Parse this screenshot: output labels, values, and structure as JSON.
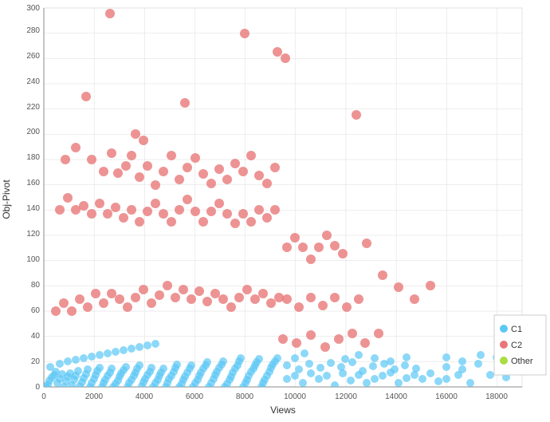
{
  "chart": {
    "title": "",
    "x_axis_label": "Views",
    "y_axis_label": "Obj-Pivot",
    "x_ticks": [
      0,
      2000,
      4000,
      6000,
      8000,
      10000,
      12000,
      14000,
      16000,
      18000
    ],
    "y_ticks": [
      0,
      20,
      40,
      60,
      80,
      100,
      120,
      140,
      160,
      180,
      200,
      220,
      240,
      260,
      280,
      300
    ],
    "legend": [
      {
        "label": "C1",
        "color": "#5BC8F5"
      },
      {
        "label": "C2",
        "color": "#E87878"
      },
      {
        "label": "Other",
        "color": "#AADD44"
      }
    ]
  }
}
